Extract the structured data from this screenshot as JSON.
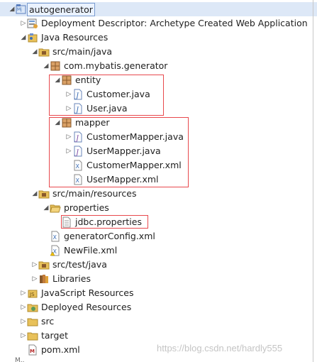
{
  "tree": [
    {
      "name": "autogenerator",
      "icon": "java-project-icon",
      "toggle": "open",
      "selected": true
    },
    {
      "name": "Deployment Descriptor: Archetype Created Web Application",
      "icon": "deployment-descriptor-icon",
      "toggle": "closed"
    },
    {
      "name": "Java Resources",
      "icon": "java-resources-icon",
      "toggle": "open"
    },
    {
      "name": "src/main/java",
      "icon": "source-folder-icon",
      "toggle": "open"
    },
    {
      "name": "com.mybatis.generator",
      "icon": "package-icon",
      "toggle": "open"
    },
    {
      "name": "entity",
      "icon": "package-icon",
      "toggle": "open"
    },
    {
      "name": "Customer.java",
      "icon": "java-file-icon",
      "toggle": "closed"
    },
    {
      "name": "User.java",
      "icon": "java-file-icon",
      "toggle": "closed"
    },
    {
      "name": "mapper",
      "icon": "package-icon",
      "toggle": "open"
    },
    {
      "name": "CustomerMapper.java",
      "icon": "java-interface-icon",
      "toggle": "closed"
    },
    {
      "name": "UserMapper.java",
      "icon": "java-interface-icon",
      "toggle": "closed"
    },
    {
      "name": "CustomerMapper.xml",
      "icon": "xml-file-icon",
      "toggle": "none"
    },
    {
      "name": "UserMapper.xml",
      "icon": "xml-file-icon",
      "toggle": "none"
    },
    {
      "name": "src/main/resources",
      "icon": "source-folder-icon",
      "toggle": "open"
    },
    {
      "name": "properties",
      "icon": "open-folder-icon",
      "toggle": "open"
    },
    {
      "name": "jdbc.properties",
      "icon": "properties-file-icon",
      "toggle": "none"
    },
    {
      "name": "generatorConfig.xml",
      "icon": "xml-file-icon",
      "toggle": "none"
    },
    {
      "name": "NewFile.xml",
      "icon": "xml-warning-icon",
      "toggle": "none"
    },
    {
      "name": "src/test/java",
      "icon": "source-folder-icon",
      "toggle": "closed"
    },
    {
      "name": "Libraries",
      "icon": "libraries-icon",
      "toggle": "closed"
    },
    {
      "name": "JavaScript Resources",
      "icon": "javascript-resources-icon",
      "toggle": "closed"
    },
    {
      "name": "Deployed Resources",
      "icon": "deployed-resources-icon",
      "toggle": "closed"
    },
    {
      "name": "src",
      "icon": "folder-icon",
      "toggle": "closed"
    },
    {
      "name": "target",
      "icon": "folder-icon",
      "toggle": "closed"
    },
    {
      "name": "pom.xml",
      "icon": "maven-pom-icon",
      "toggle": "none"
    }
  ],
  "watermark": "https://blog.csdn.net/hardly555",
  "colors": {
    "highlight_box": "#e8494d",
    "selection": "#dde8f7",
    "package": "#b8702c",
    "folder": "#e8c15a",
    "java_file": "#3b6db5"
  }
}
